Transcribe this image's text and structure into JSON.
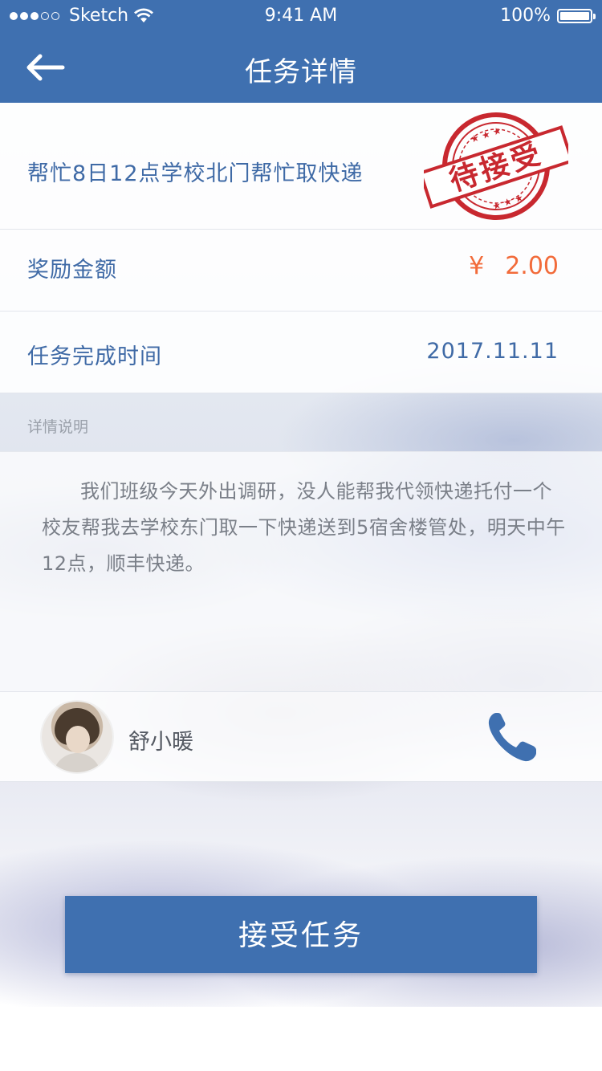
{
  "status_bar": {
    "carrier": "Sketch",
    "time": "9:41 AM",
    "battery": "100%"
  },
  "header": {
    "title": "任务详情"
  },
  "task": {
    "title": "帮忙8日12点学校北门帮忙取快递",
    "stamp_text": "待接受",
    "reward_label": "奖励金额",
    "reward_currency": "¥",
    "reward_value": "2.00",
    "time_label": "任务完成时间",
    "time_value": "2017.11.11"
  },
  "details": {
    "section_label": "详情说明",
    "text": "我们班级今天外出调研，没人能帮我代领快递托付一个校友帮我去学校东门取一下快递送到5宿舍楼管处，明天中午12点，顺丰快递。"
  },
  "poster": {
    "name": "舒小暖"
  },
  "actions": {
    "accept_label": "接受任务"
  },
  "icons": {
    "back": "back-arrow-icon",
    "wifi": "wifi-icon",
    "phone": "phone-icon"
  },
  "colors": {
    "primary": "#3f70b0",
    "reward": "#f26b3a",
    "stamp": "#c8282f"
  }
}
